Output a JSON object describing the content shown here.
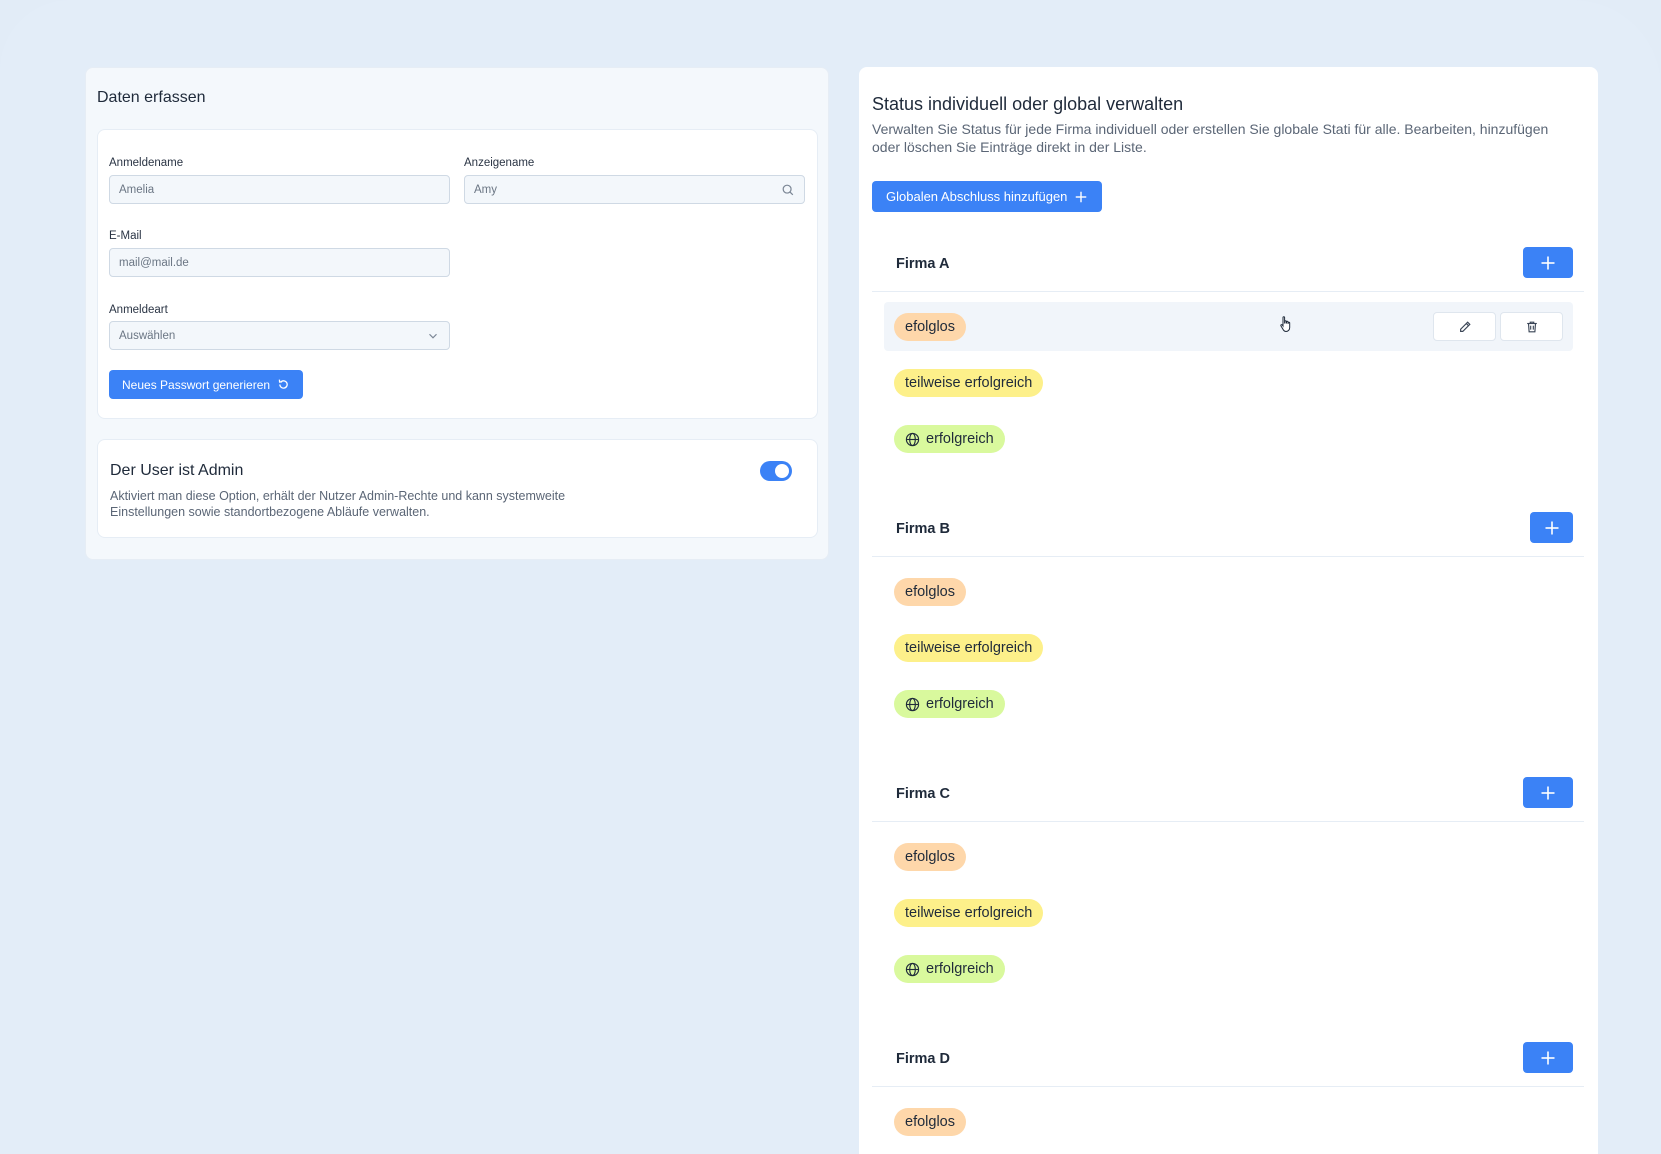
{
  "left": {
    "title": "Daten erfassen",
    "fields": {
      "login_name": {
        "label": "Anmeldename",
        "value": "Amelia"
      },
      "display_name": {
        "label": "Anzeigename",
        "value": "Amy"
      },
      "email": {
        "label": "E-Mail",
        "value": "mail@mail.de"
      },
      "login_type": {
        "label": "Anmeldeart",
        "value": "Auswählen"
      }
    },
    "generate_password_label": "Neues Passwort generieren",
    "admin": {
      "title": "Der User ist Admin",
      "description": "Aktiviert man diese Option, erhält der Nutzer Admin-Rechte und kann systemweite Einstellungen sowie standortbezogene Abläufe verwalten.",
      "enabled": true
    }
  },
  "right": {
    "title": "Status individuell oder global verwalten",
    "description": "Verwalten Sie Status für jede Firma individuell oder erstellen Sie globale Stati für alle. Bearbeiten, hinzufügen oder löschen Sie Einträge direkt in der Liste.",
    "global_add_label": "Globalen Abschluss hinzufügen",
    "companies": [
      {
        "name": "Firma A",
        "statuses": [
          "efolglos",
          "teilweise erfolgreich",
          "erfolgreich"
        ]
      },
      {
        "name": "Firma B",
        "statuses": [
          "efolglos",
          "teilweise erfolgreich",
          "erfolgreich"
        ]
      },
      {
        "name": "Firma C",
        "statuses": [
          "efolglos",
          "teilweise erfolgreich",
          "erfolgreich"
        ]
      },
      {
        "name": "Firma D",
        "statuses": [
          "efolglos"
        ]
      }
    ]
  },
  "colors": {
    "primary": "#3b82f6",
    "badge_orange": "#fed7aa",
    "badge_yellow": "#fdf08a",
    "badge_green": "#d9f99d"
  }
}
